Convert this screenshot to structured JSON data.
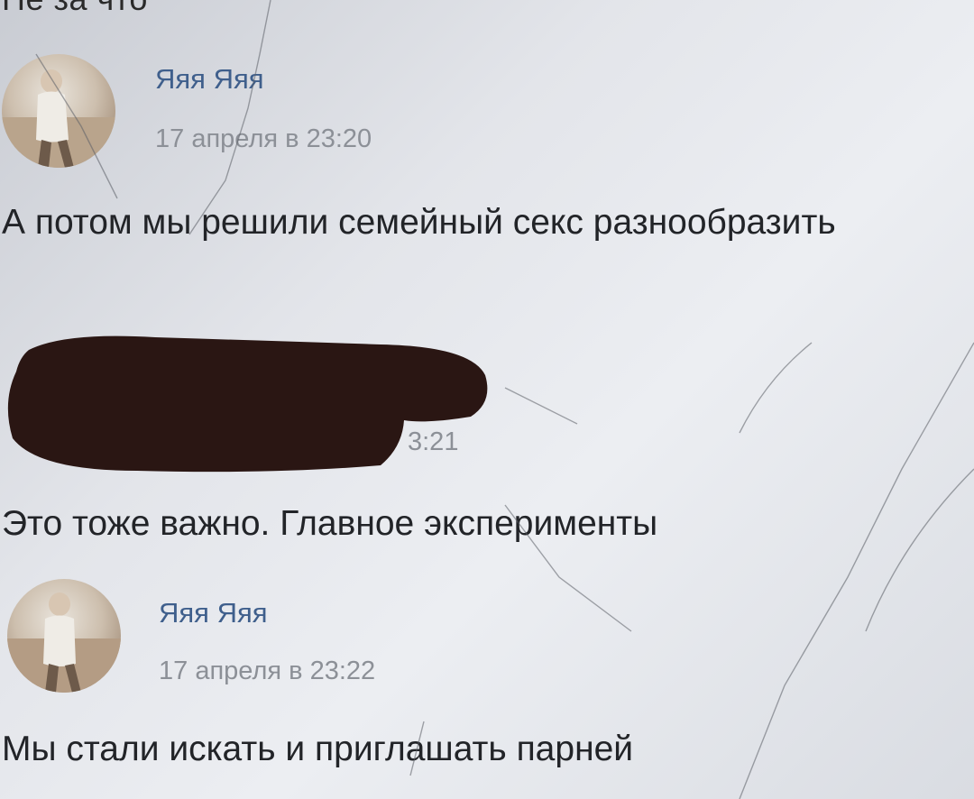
{
  "header": {
    "clipped_text": "Не за что"
  },
  "comments": [
    {
      "author": "Яяя Яяя",
      "time": "17 апреля в 23:20",
      "text": "А потом мы решили семейный секс разнообразить"
    },
    {
      "author": "",
      "time": "3:21",
      "text": "Это тоже важно. Главное эксперименты"
    },
    {
      "author": "Яяя Яяя",
      "time": "17 апреля в 23:22",
      "text": "Мы стали искать и приглашать парней"
    }
  ],
  "colors": {
    "author_link": "#3f5f8c",
    "timestamp": "#8c9097",
    "message_text": "#222428",
    "redaction": "#2a1613"
  }
}
